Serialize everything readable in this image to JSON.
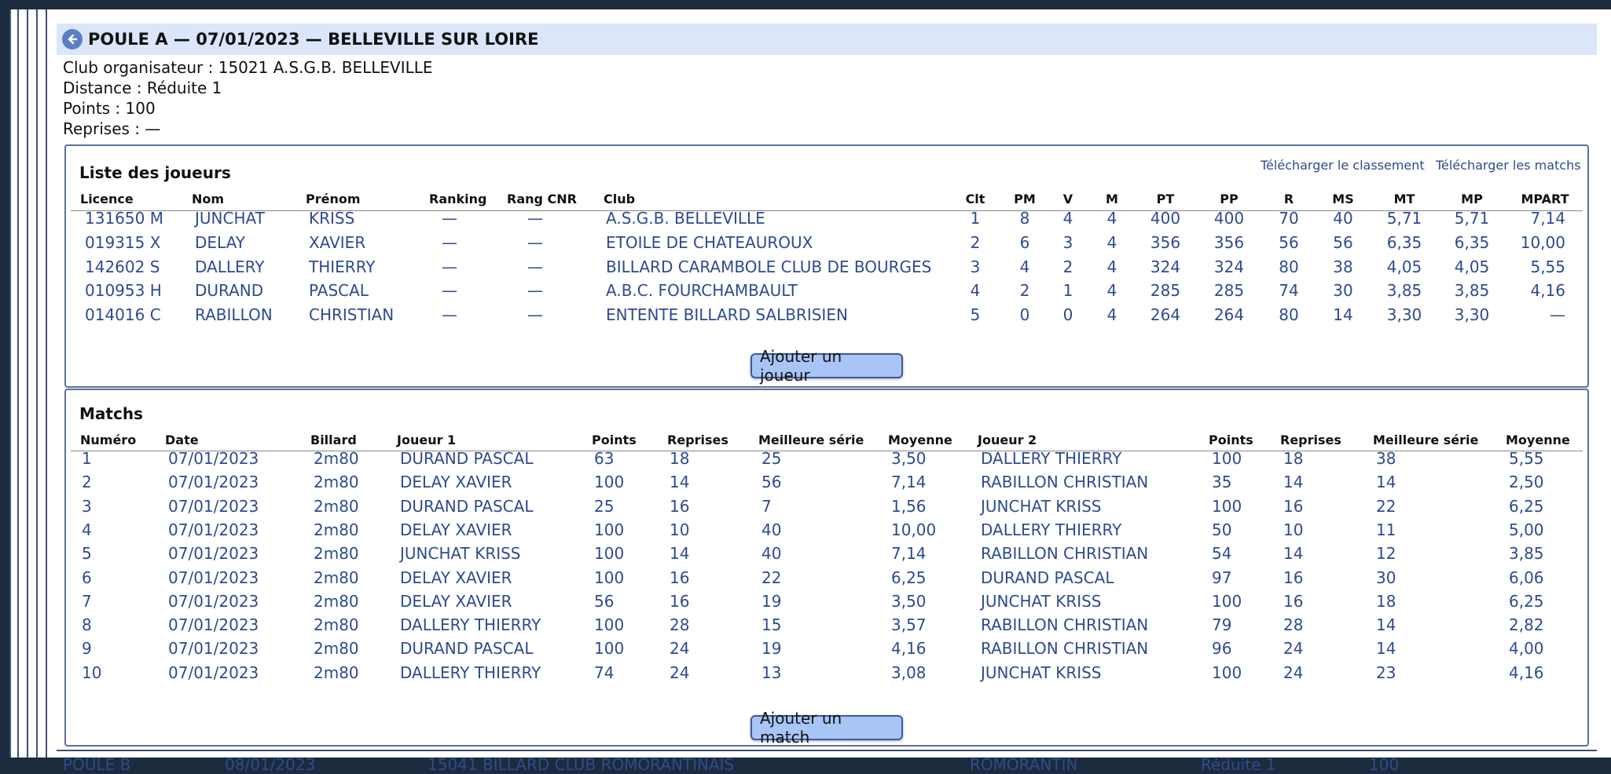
{
  "poule": {
    "title": "POULE A — 07/01/2023 — BELLEVILLE SUR LOIRE",
    "organizer": "Club organisateur : 15021 A.S.G.B. BELLEVILLE",
    "distance": "Distance : Réduite 1",
    "points": "Points : 100",
    "reprises": "Reprises : —"
  },
  "players": {
    "title": "Liste des joueurs",
    "download_ranking": "Télécharger le classement",
    "download_matches": "Télécharger les matchs",
    "headers": [
      "Licence",
      "Nom",
      "Prénom",
      "Ranking",
      "Rang CNR",
      "Club",
      "Clt",
      "PM",
      "V",
      "M",
      "PT",
      "PP",
      "R",
      "MS",
      "MT",
      "MP",
      "MPART"
    ],
    "rows": [
      [
        "131650 M",
        "JUNCHAT",
        "KRISS",
        "—",
        "—",
        "A.S.G.B. BELLEVILLE",
        "1",
        "8",
        "4",
        "4",
        "400",
        "400",
        "70",
        "40",
        "5,71",
        "5,71",
        "7,14"
      ],
      [
        "019315 X",
        "DELAY",
        "XAVIER",
        "—",
        "—",
        "ETOILE DE CHATEAUROUX",
        "2",
        "6",
        "3",
        "4",
        "356",
        "356",
        "56",
        "56",
        "6,35",
        "6,35",
        "10,00"
      ],
      [
        "142602 S",
        "DALLERY",
        "THIERRY",
        "—",
        "—",
        "BILLARD CARAMBOLE CLUB DE BOURGES",
        "3",
        "4",
        "2",
        "4",
        "324",
        "324",
        "80",
        "38",
        "4,05",
        "4,05",
        "5,55"
      ],
      [
        "010953 H",
        "DURAND",
        "PASCAL",
        "—",
        "—",
        "A.B.C. FOURCHAMBAULT",
        "4",
        "2",
        "1",
        "4",
        "285",
        "285",
        "74",
        "30",
        "3,85",
        "3,85",
        "4,16"
      ],
      [
        "014016 C",
        "RABILLON",
        "CHRISTIAN",
        "—",
        "—",
        "ENTENTE BILLARD SALBRISIEN",
        "5",
        "0",
        "0",
        "4",
        "264",
        "264",
        "80",
        "14",
        "3,30",
        "3,30",
        "—"
      ]
    ],
    "add_button": "Ajouter un joueur"
  },
  "matches": {
    "title": "Matchs",
    "headers": [
      "Numéro",
      "Date",
      "Billard",
      "Joueur 1",
      "Points",
      "Reprises",
      "Meilleure série",
      "Moyenne",
      "Joueur 2",
      "Points",
      "Reprises",
      "Meilleure série",
      "Moyenne"
    ],
    "rows": [
      [
        "1",
        "07/01/2023",
        "2m80",
        "DURAND PASCAL",
        "63",
        "18",
        "25",
        "3,50",
        "DALLERY THIERRY",
        "100",
        "18",
        "38",
        "5,55"
      ],
      [
        "2",
        "07/01/2023",
        "2m80",
        "DELAY XAVIER",
        "100",
        "14",
        "56",
        "7,14",
        "RABILLON CHRISTIAN",
        "35",
        "14",
        "14",
        "2,50"
      ],
      [
        "3",
        "07/01/2023",
        "2m80",
        "DURAND PASCAL",
        "25",
        "16",
        "7",
        "1,56",
        "JUNCHAT KRISS",
        "100",
        "16",
        "22",
        "6,25"
      ],
      [
        "4",
        "07/01/2023",
        "2m80",
        "DELAY XAVIER",
        "100",
        "10",
        "40",
        "10,00",
        "DALLERY THIERRY",
        "50",
        "10",
        "11",
        "5,00"
      ],
      [
        "5",
        "07/01/2023",
        "2m80",
        "JUNCHAT KRISS",
        "100",
        "14",
        "40",
        "7,14",
        "RABILLON CHRISTIAN",
        "54",
        "14",
        "12",
        "3,85"
      ],
      [
        "6",
        "07/01/2023",
        "2m80",
        "DELAY XAVIER",
        "100",
        "16",
        "22",
        "6,25",
        "DURAND PASCAL",
        "97",
        "16",
        "30",
        "6,06"
      ],
      [
        "7",
        "07/01/2023",
        "2m80",
        "DELAY XAVIER",
        "56",
        "16",
        "19",
        "3,50",
        "JUNCHAT KRISS",
        "100",
        "16",
        "18",
        "6,25"
      ],
      [
        "8",
        "07/01/2023",
        "2m80",
        "DALLERY THIERRY",
        "100",
        "28",
        "15",
        "3,57",
        "RABILLON CHRISTIAN",
        "79",
        "28",
        "14",
        "2,82"
      ],
      [
        "9",
        "07/01/2023",
        "2m80",
        "DURAND PASCAL",
        "100",
        "24",
        "19",
        "4,16",
        "RABILLON CHRISTIAN",
        "96",
        "24",
        "14",
        "4,00"
      ],
      [
        "10",
        "07/01/2023",
        "2m80",
        "DALLERY THIERRY",
        "74",
        "24",
        "13",
        "3,08",
        "JUNCHAT KRISS",
        "100",
        "24",
        "23",
        "4,16"
      ]
    ],
    "add_button": "Ajouter un match"
  },
  "next_poule": {
    "cells": [
      "POULE B",
      "08/01/2023",
      "15041 BILLARD CLUB ROMORANTINAIS",
      "ROMORANTIN",
      "Réduite 1",
      "100"
    ]
  }
}
